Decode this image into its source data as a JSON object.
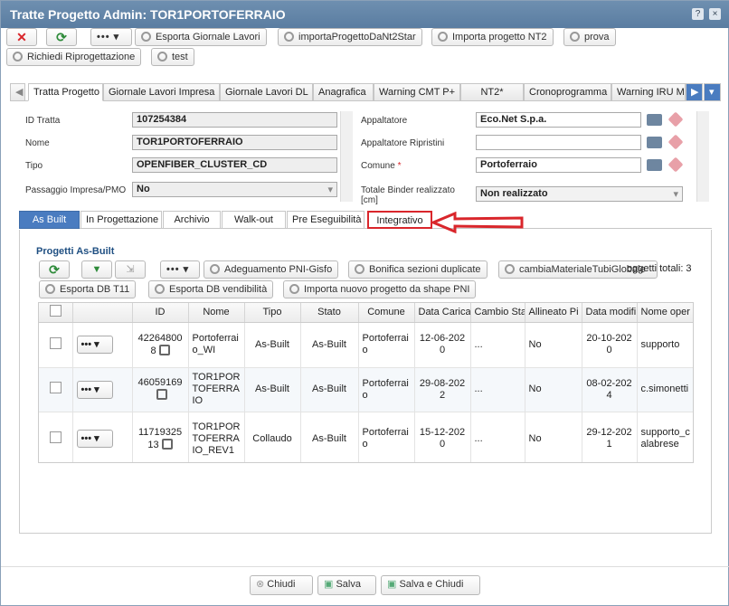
{
  "window": {
    "title": "Tratte Progetto Admin: TOR1PORTOFERRAIO",
    "help_icon": "?",
    "close_icon": "×"
  },
  "toolbar": {
    "buttons": [
      "Esporta Giornale Lavori",
      "importaProgettoDaNt2Star",
      "Importa progetto NT2",
      "prova",
      "Richiedi Riprogettazione",
      "test"
    ],
    "more": "•••"
  },
  "main_tabs": [
    "Tratta Progetto",
    "Giornale Lavori Impresa",
    "Giornale Lavori DL",
    "Anagrafica",
    "Warning CMT P+",
    "NT2*",
    "Cronoprogramma",
    "Warning IRU M"
  ],
  "form": {
    "id_label": "ID Tratta",
    "id_value": "107254384",
    "nome_label": "Nome",
    "nome_value": "TOR1PORTOFERRAIO",
    "tipo_label": "Tipo",
    "tipo_value": "OPENFIBER_CLUSTER_CD",
    "passaggio_label": "Passaggio Impresa/PMO",
    "passaggio_value": "No",
    "appaltatore_label": "Appaltatore",
    "appaltatore_value": "Eco.Net S.p.a.",
    "ripristini_label": "Appaltatore Ripristini",
    "ripristini_value": "",
    "comune_label": "Comune",
    "comune_required": "*",
    "comune_value": "Portoferraio",
    "binder_label": "Totale Binder realizzato [cm]",
    "binder_value": "Non realizzato"
  },
  "sub_tabs": [
    "As Built",
    "In Progettazione",
    "Archivio",
    "Walk-out",
    "Pre Eseguibilità",
    "Integrativo"
  ],
  "section_title": "Progetti As-Built",
  "grid_toolbar": {
    "buttons": [
      "Adeguamento PNI-Gisfo",
      "Bonifica sezioni duplicate",
      "cambiaMaterialeTubiGlobale",
      "Esporta DB T11",
      "Esporta DB vendibilità",
      "Importa nuovo progetto da shape PNI"
    ],
    "total_label": "oggetti totali: 3"
  },
  "grid": {
    "columns": [
      "ID",
      "Nome",
      "Tipo",
      "Stato",
      "Comune",
      "Data Carica",
      "Cambio Sta",
      "Allineato Pi",
      "Data modifi",
      "Nome oper"
    ],
    "rows": [
      {
        "id": "422648008",
        "nome": "Portoferraio_WI",
        "tipo": "As-Built",
        "stato": "As-Built",
        "comune": "Portoferraio",
        "data_carica": "12-06-2020",
        "cambio": "...",
        "allineato": "No",
        "data_mod": "20-10-2020",
        "operatore": "supporto"
      },
      {
        "id": "46059169",
        "nome": "TOR1PORTOFERRAIO",
        "tipo": "As-Built",
        "stato": "As-Built",
        "comune": "Portoferraio",
        "data_carica": "29-08-2022",
        "cambio": "...",
        "allineato": "No",
        "data_mod": "08-02-2024",
        "operatore": "c.simonetti"
      },
      {
        "id": "1171932513",
        "nome": "TOR1PORTOFERRAIO_REV1",
        "tipo": "Collaudo",
        "stato": "As-Built",
        "comune": "Portoferraio",
        "data_carica": "15-12-2020",
        "cambio": "...",
        "allineato": "No",
        "data_mod": "29-12-2021",
        "operatore": "supporto_calabrese"
      }
    ]
  },
  "footer": {
    "chiudi": "Chiudi",
    "salva": "Salva",
    "salva_chiudi": "Salva e Chiudi"
  },
  "colors": {
    "title_bg": "#5a7da1",
    "highlight": "#d9262b",
    "accent_green": "#2e8b3a"
  }
}
